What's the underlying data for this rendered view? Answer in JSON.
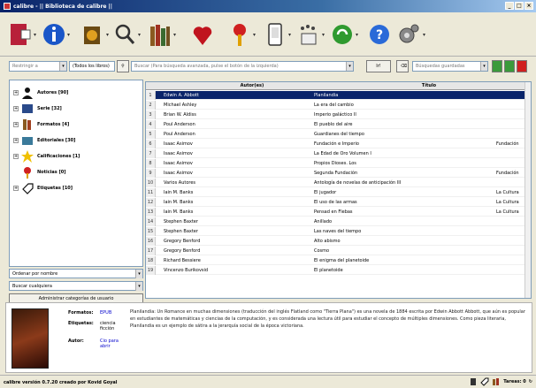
{
  "window": {
    "title": "calibre - || Biblioteca de calibre ||"
  },
  "toolbar": {
    "colors": {
      "add": "#b8203a",
      "info": "#1a56c8",
      "heart": "#c0141e",
      "recycle": "#2f9a2f"
    },
    "icons": [
      "add-books-icon",
      "book-info-icon",
      "convert-books-icon",
      "search-icon",
      "library-icon",
      "heart-icon",
      "news-icon",
      "device-icon",
      "connect-share-icon",
      "remove-books-icon",
      "help-icon",
      "preferences-icon"
    ]
  },
  "search": {
    "restrict": "Restringir a",
    "all_books": "(Todos los libros)",
    "query_placeholder": "Buscar (Para búsqueda avanzada, pulse el botón de la izquierda)",
    "go_label": "Ir!",
    "saved_placeholder": "Búsquedas guardadas"
  },
  "tree": {
    "items": [
      {
        "label": "Autores [90]",
        "icon": "user-icon"
      },
      {
        "label": "Serie [32]",
        "icon": "series-icon"
      },
      {
        "label": "Formatos [4]",
        "icon": "formats-icon"
      },
      {
        "label": "Editoriales [30]",
        "icon": "publisher-icon"
      },
      {
        "label": "Calificaciones [1]",
        "icon": "star-icon"
      },
      {
        "label": "Noticias [0]",
        "icon": "news-icon"
      },
      {
        "label": "Etiquetas [10]",
        "icon": "tag-icon"
      }
    ]
  },
  "leftctrls": {
    "sort": "Ordenar por nombre",
    "match": "Buscar cualquiera",
    "manage": "Administrar categorías de usuario"
  },
  "table": {
    "headers": {
      "author": "Autor(es)",
      "title": "Título"
    },
    "rows": [
      {
        "n": "1",
        "author": "Edwin A. Abbott",
        "title": "Planilandia",
        "series": ""
      },
      {
        "n": "2",
        "author": "Michael Ashley",
        "title": "La era del cambio",
        "series": ""
      },
      {
        "n": "3",
        "author": "Brian W. Aldiss",
        "title": "Imperio galáctico II",
        "series": ""
      },
      {
        "n": "4",
        "author": "Poul Anderson",
        "title": "El pueblo del aire",
        "series": ""
      },
      {
        "n": "5",
        "author": "Poul Anderson",
        "title": "Guardianes del tiempo",
        "series": ""
      },
      {
        "n": "6",
        "author": "Isaac Asimov",
        "title": "Fundación e Imperio",
        "series": "Fundación"
      },
      {
        "n": "7",
        "author": "Isaac Asimov",
        "title": "La Edad de Oro Volumen I",
        "series": ""
      },
      {
        "n": "8",
        "author": "Isaac Asimov",
        "title": "Propios Dioses. Los",
        "series": ""
      },
      {
        "n": "9",
        "author": "Isaac Asimov",
        "title": "Segunda Fundación",
        "series": "Fundación"
      },
      {
        "n": "10",
        "author": "Varios Autores",
        "title": "Antología de novelas de anticipación III",
        "series": ""
      },
      {
        "n": "11",
        "author": "Iain M. Banks",
        "title": "El jugador",
        "series": "La Cultura"
      },
      {
        "n": "12",
        "author": "Iain M. Banks",
        "title": "El uso de las armas",
        "series": "La Cultura"
      },
      {
        "n": "13",
        "author": "Iain M. Banks",
        "title": "Pensad en Flebas",
        "series": "La Cultura"
      },
      {
        "n": "14",
        "author": "Stephen Baxter",
        "title": "Anillado",
        "series": ""
      },
      {
        "n": "15",
        "author": "Stephen Baxter",
        "title": "Las naves del tiempo",
        "series": ""
      },
      {
        "n": "16",
        "author": "Gregory Benford",
        "title": "Alto abismo",
        "series": ""
      },
      {
        "n": "17",
        "author": "Gregory Benford",
        "title": "Cosmo",
        "series": ""
      },
      {
        "n": "18",
        "author": "Richard Bessiere",
        "title": "El enigma del planetoide",
        "series": ""
      },
      {
        "n": "19",
        "author": "Vincenzo Burikovsid",
        "title": "El planetoide",
        "series": ""
      }
    ]
  },
  "details": {
    "formats_label": "Formatos:",
    "formats_value": "EPUB",
    "tags_label": "Etiquetas:",
    "tags_value": "ciencia ficción",
    "author_label": "Autor:",
    "author_value": "Cio para abrir",
    "comment": "Planilandia: Un Romance en muchas dimensiones (traducción del inglés Flatland como \"Tierra Plana\") es una novela de 1884 escrita por Edwin Abbott Abbott, que aún es popular en estudiantes de matemáticas y ciencias de la computación, y es considerada una lectura útil para estudiar el concepto de múltiples dimensiones. Como pieza literaria, Planilandia es un ejemplo de sátira a la jerarquía social de la época victoriana."
  },
  "status": {
    "text": "calibre versión 0.7.20 creado por Kovid Goyal",
    "jobs": "Tareas: 0"
  }
}
